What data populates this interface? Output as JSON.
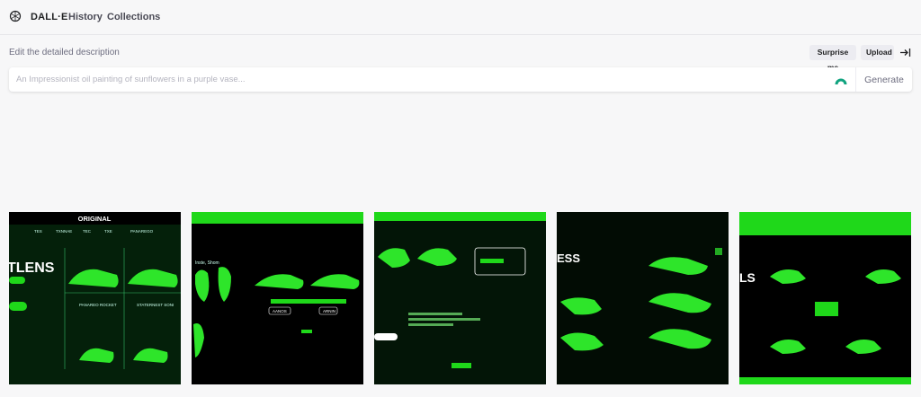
{
  "header": {
    "brand": "DALL·E",
    "nav": [
      "History",
      "Collections"
    ],
    "logo_icon": "openai-logo-icon"
  },
  "prompt": {
    "label": "Edit the detailed description",
    "placeholder": "An Impressionist oil painting of sunflowers in a purple vase...",
    "value": "",
    "surprise_label": "Surprise me",
    "upload_label": "Upload",
    "generate_label": "Generate",
    "collapse_icon": "collapse-panel-icon",
    "prompt_icon": "arc-icon"
  },
  "gallery": {
    "images": [
      {
        "title": "ORIGINAL",
        "big_text": "TLENS",
        "cols": [
          "TES",
          "TXNNAE",
          "TEC",
          "TXE",
          "PANAREGO"
        ],
        "captions": [
          "PANAREO ROCKET",
          "STATERNEST SONI"
        ]
      },
      {
        "title": "",
        "big_text": "",
        "cols": [
          "Inste, Shom"
        ],
        "captions": [
          "AANOS",
          "ARNIN"
        ]
      },
      {
        "title": "",
        "big_text": "",
        "cols": [],
        "captions": []
      },
      {
        "title": "",
        "big_text": "ESS",
        "cols": [],
        "captions": []
      },
      {
        "title": "",
        "big_text": "LS",
        "cols": [],
        "captions": []
      }
    ]
  },
  "colors": {
    "accent": "#10a37f",
    "neon_green": "#1fd81a",
    "dark_bg": "#041a08"
  }
}
